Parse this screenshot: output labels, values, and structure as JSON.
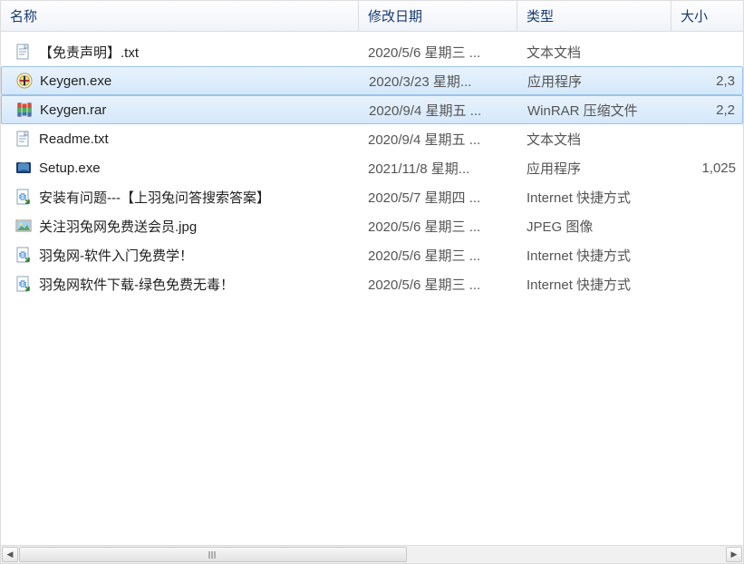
{
  "columns": {
    "name": "名称",
    "date": "修改日期",
    "type": "类型",
    "size": "大小"
  },
  "files": [
    {
      "name": "【免责声明】.txt",
      "date": "2020/5/6 星期三 ...",
      "type": "文本文档",
      "size": "",
      "icon": "txt",
      "selected": false
    },
    {
      "name": "Keygen.exe",
      "date": "2020/3/23 星期...",
      "type": "应用程序",
      "size": "2,3",
      "icon": "keygen",
      "selected": true
    },
    {
      "name": "Keygen.rar",
      "date": "2020/9/4 星期五 ...",
      "type": "WinRAR 压缩文件",
      "size": "2,2",
      "icon": "rar",
      "selected": true
    },
    {
      "name": "Readme.txt",
      "date": "2020/9/4 星期五 ...",
      "type": "文本文档",
      "size": "",
      "icon": "txt",
      "selected": false
    },
    {
      "name": "Setup.exe",
      "date": "2021/11/8 星期...",
      "type": "应用程序",
      "size": "1,025",
      "icon": "setup",
      "selected": false
    },
    {
      "name": "安装有问题---【上羽兔问答搜索答案】",
      "date": "2020/5/7 星期四 ...",
      "type": "Internet 快捷方式",
      "size": "",
      "icon": "url",
      "selected": false
    },
    {
      "name": "关注羽兔网免费送会员.jpg",
      "date": "2020/5/6 星期三 ...",
      "type": "JPEG 图像",
      "size": "",
      "icon": "jpg",
      "selected": false
    },
    {
      "name": "羽兔网-软件入门免费学！",
      "date": "2020/5/6 星期三 ...",
      "type": "Internet 快捷方式",
      "size": "",
      "icon": "url",
      "selected": false
    },
    {
      "name": "羽兔网软件下载-绿色免费无毒！",
      "date": "2020/5/6 星期三 ...",
      "type": "Internet 快捷方式",
      "size": "",
      "icon": "url",
      "selected": false
    }
  ]
}
